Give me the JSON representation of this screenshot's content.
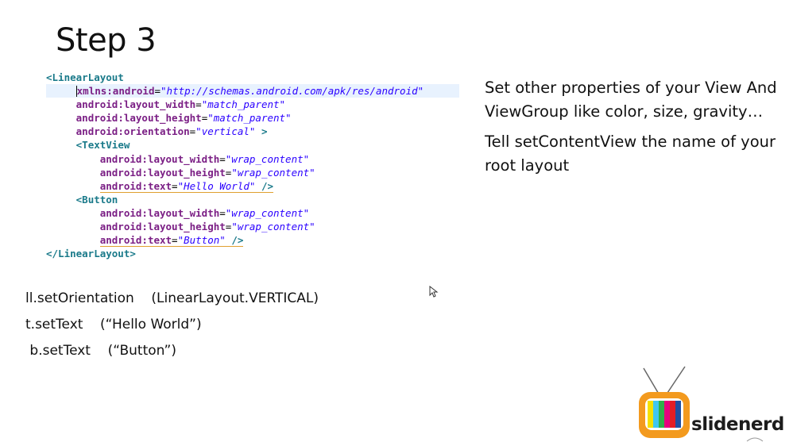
{
  "slide": {
    "title": "Step 3",
    "code_lines": [
      {
        "indent": 0,
        "tokens": [
          {
            "t": "tag",
            "v": "<LinearLayout"
          }
        ]
      },
      {
        "indent": 1,
        "highlight": true,
        "caret": true,
        "tokens": [
          {
            "t": "attr",
            "v": "xmlns:android"
          },
          {
            "t": "eq",
            "v": "="
          },
          {
            "t": "val",
            "v": "\"http://schemas.android.com/apk/res/android\""
          }
        ]
      },
      {
        "indent": 1,
        "tokens": [
          {
            "t": "attr",
            "v": "android:layout_width"
          },
          {
            "t": "eq",
            "v": "="
          },
          {
            "t": "val",
            "v": "\"match_parent\""
          }
        ]
      },
      {
        "indent": 1,
        "tokens": [
          {
            "t": "attr",
            "v": "android:layout_height"
          },
          {
            "t": "eq",
            "v": "="
          },
          {
            "t": "val",
            "v": "\"match_parent\""
          }
        ]
      },
      {
        "indent": 1,
        "tokens": [
          {
            "t": "attr",
            "v": "android:orientation"
          },
          {
            "t": "eq",
            "v": "="
          },
          {
            "t": "val",
            "v": "\"vertical\""
          },
          {
            "t": "tag",
            "v": " >"
          }
        ]
      },
      {
        "indent": 1,
        "tokens": [
          {
            "t": "tag",
            "v": "<TextView"
          }
        ]
      },
      {
        "indent": 2,
        "tokens": [
          {
            "t": "attr",
            "v": "android:layout_width"
          },
          {
            "t": "eq",
            "v": "="
          },
          {
            "t": "val",
            "v": "\"wrap_content\""
          }
        ]
      },
      {
        "indent": 2,
        "tokens": [
          {
            "t": "attr",
            "v": "android:layout_height"
          },
          {
            "t": "eq",
            "v": "="
          },
          {
            "t": "val",
            "v": "\"wrap_content\""
          }
        ]
      },
      {
        "indent": 2,
        "underline": true,
        "tokens": [
          {
            "t": "attr",
            "v": "android:text"
          },
          {
            "t": "eq",
            "v": "="
          },
          {
            "t": "val",
            "v": "\"Hello World\""
          },
          {
            "t": "tag",
            "v": " />"
          }
        ]
      },
      {
        "indent": 1,
        "tokens": [
          {
            "t": "tag",
            "v": "<Button"
          }
        ]
      },
      {
        "indent": 2,
        "tokens": [
          {
            "t": "attr",
            "v": "android:layout_width"
          },
          {
            "t": "eq",
            "v": "="
          },
          {
            "t": "val",
            "v": "\"wrap_content\""
          }
        ]
      },
      {
        "indent": 2,
        "tokens": [
          {
            "t": "attr",
            "v": "android:layout_height"
          },
          {
            "t": "eq",
            "v": "="
          },
          {
            "t": "val",
            "v": "\"wrap_content\""
          }
        ]
      },
      {
        "indent": 2,
        "underline": true,
        "tokens": [
          {
            "t": "attr",
            "v": "android:text"
          },
          {
            "t": "eq",
            "v": "="
          },
          {
            "t": "val",
            "v": "\"Button\""
          },
          {
            "t": "tag",
            "v": " />"
          }
        ]
      },
      {
        "indent": 0,
        "tokens": [
          {
            "t": "tag",
            "v": "</LinearLayout>"
          }
        ]
      }
    ],
    "right_paragraphs": [
      "Set other properties of your View And ViewGroup like color, size, gravity…",
      "Tell setContentView the name of your root layout"
    ],
    "java_lines": [
      "ll.setOrientation    (LinearLayout.VERTICAL)",
      "t.setText    (“Hello World”)",
      " b.setText    (“Button”)"
    ],
    "brand": "slidenerd",
    "colors": {
      "tag": "#1a7a8a",
      "attr": "#7b1f85",
      "value": "#2a00ff",
      "highlight": "#e8f2fe"
    },
    "icons": {
      "cursor": "mouse-pointer-icon",
      "logo": "retro-tv-logo"
    }
  }
}
